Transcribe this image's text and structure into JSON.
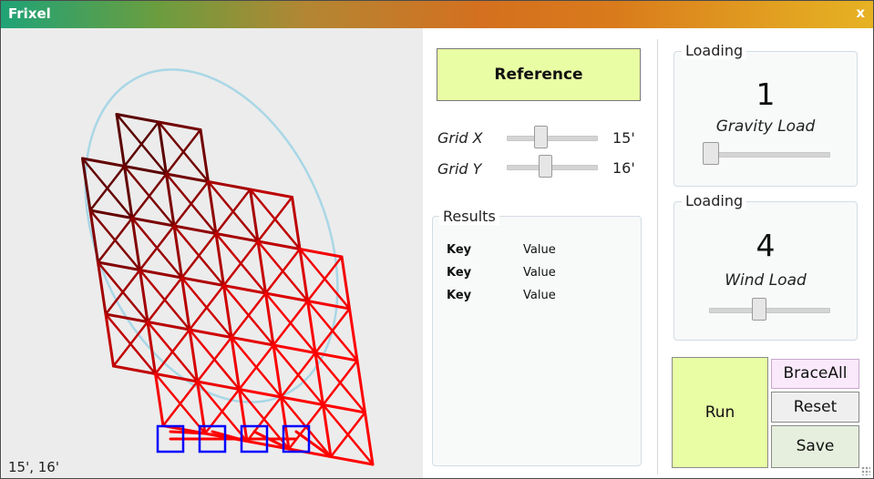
{
  "window": {
    "title": "Frixel",
    "close_label": "x"
  },
  "canvas": {
    "coords_text": "15', 16'",
    "colors": {
      "background": "#ececec",
      "frame_dark": "#2a0000",
      "frame_light": "#ff0000",
      "support": "#0000ff",
      "outline": "#a9d7e6"
    }
  },
  "reference": {
    "label": "Reference"
  },
  "grid_x": {
    "label": "Grid X",
    "value_text": "15'",
    "level": 0.33
  },
  "grid_y": {
    "label": "Grid Y",
    "value_text": "16'",
    "level": 0.4
  },
  "results": {
    "title": "Results",
    "rows": [
      {
        "key": "Key",
        "value": "Value"
      },
      {
        "key": "Key",
        "value": "Value"
      },
      {
        "key": "Key",
        "value": "Value"
      }
    ]
  },
  "gravity": {
    "title": "Loading",
    "number": "1",
    "label": "Gravity Load",
    "level": 0.0
  },
  "wind": {
    "title": "Loading",
    "number": "4",
    "label": "Wind Load",
    "level": 0.44
  },
  "buttons": {
    "run": "Run",
    "brace_all": "BraceAll",
    "reset": "Reset",
    "save": "Save"
  },
  "colors": {
    "accent_green": "#e8fda4",
    "brace_pink": "#f9e9fb",
    "save_green": "#e6efdd",
    "reset_gray": "#efefef"
  }
}
